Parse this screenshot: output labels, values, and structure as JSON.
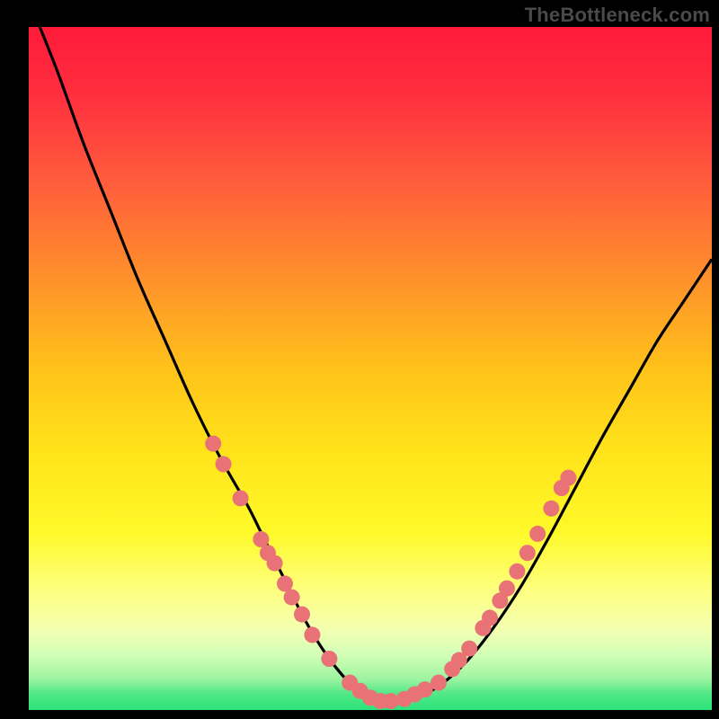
{
  "watermark": "TheBottleneck.com",
  "colors": {
    "black": "#000000",
    "curve_stroke": "#000000",
    "dot_fill": "#e97277",
    "green_band": "#2ce47b",
    "gradient_stops": [
      {
        "offset": 0.0,
        "color": "#ff1a3a"
      },
      {
        "offset": 0.1,
        "color": "#ff2f3f"
      },
      {
        "offset": 0.22,
        "color": "#ff5a3c"
      },
      {
        "offset": 0.35,
        "color": "#ff8a2d"
      },
      {
        "offset": 0.5,
        "color": "#ffc21a"
      },
      {
        "offset": 0.62,
        "color": "#ffe31a"
      },
      {
        "offset": 0.74,
        "color": "#fff92a"
      },
      {
        "offset": 0.82,
        "color": "#fdff7a"
      },
      {
        "offset": 0.88,
        "color": "#f5ffb0"
      },
      {
        "offset": 0.92,
        "color": "#d2ffb8"
      },
      {
        "offset": 0.955,
        "color": "#9cf4a0"
      },
      {
        "offset": 0.975,
        "color": "#54e888"
      },
      {
        "offset": 1.0,
        "color": "#2ce47b"
      }
    ]
  },
  "layout": {
    "inner_x": 32,
    "inner_y": 30,
    "inner_w": 760,
    "inner_h": 760
  },
  "chart_data": {
    "type": "line",
    "title": "",
    "xlabel": "",
    "ylabel": "",
    "xlim": [
      0,
      100
    ],
    "ylim": [
      0,
      100
    ],
    "series": [
      {
        "name": "bottleneck-curve",
        "x": [
          0,
          4,
          8,
          12,
          16,
          20,
          24,
          28,
          32,
          34,
          36,
          38,
          40,
          42,
          44,
          46,
          48,
          50,
          52,
          56,
          60,
          64,
          68,
          72,
          76,
          80,
          84,
          88,
          92,
          96,
          100
        ],
        "y": [
          104,
          94,
          83,
          73,
          63,
          54,
          45,
          37,
          30,
          26,
          22,
          18,
          14,
          10.5,
          7.5,
          5,
          3,
          1.5,
          1,
          1.5,
          3.5,
          7,
          12,
          18,
          25,
          32.5,
          40,
          47,
          54,
          60,
          66
        ]
      }
    ],
    "dots": [
      {
        "x": 27.0,
        "y": 39.0
      },
      {
        "x": 28.5,
        "y": 36.0
      },
      {
        "x": 31.0,
        "y": 31.0
      },
      {
        "x": 34.0,
        "y": 25.0
      },
      {
        "x": 35.0,
        "y": 23.0
      },
      {
        "x": 36.0,
        "y": 21.5
      },
      {
        "x": 37.5,
        "y": 18.5
      },
      {
        "x": 38.5,
        "y": 16.5
      },
      {
        "x": 40.0,
        "y": 14.0
      },
      {
        "x": 41.5,
        "y": 11.0
      },
      {
        "x": 44.0,
        "y": 7.5
      },
      {
        "x": 47.0,
        "y": 4.0
      },
      {
        "x": 48.5,
        "y": 2.8
      },
      {
        "x": 50.0,
        "y": 1.8
      },
      {
        "x": 51.5,
        "y": 1.3
      },
      {
        "x": 53.0,
        "y": 1.3
      },
      {
        "x": 55.0,
        "y": 1.6
      },
      {
        "x": 56.5,
        "y": 2.3
      },
      {
        "x": 58.0,
        "y": 3.0
      },
      {
        "x": 60.0,
        "y": 4.0
      },
      {
        "x": 62.0,
        "y": 6.0
      },
      {
        "x": 63.0,
        "y": 7.3
      },
      {
        "x": 64.5,
        "y": 9.0
      },
      {
        "x": 66.5,
        "y": 12.0
      },
      {
        "x": 67.5,
        "y": 13.5
      },
      {
        "x": 69.0,
        "y": 16.0
      },
      {
        "x": 70.0,
        "y": 17.8
      },
      {
        "x": 71.5,
        "y": 20.3
      },
      {
        "x": 73.0,
        "y": 23.0
      },
      {
        "x": 74.5,
        "y": 25.8
      },
      {
        "x": 76.5,
        "y": 29.5
      },
      {
        "x": 78.0,
        "y": 32.5
      },
      {
        "x": 79.0,
        "y": 34.0
      }
    ],
    "dot_radius_px": 9,
    "curve_stroke_px": 3.2
  }
}
